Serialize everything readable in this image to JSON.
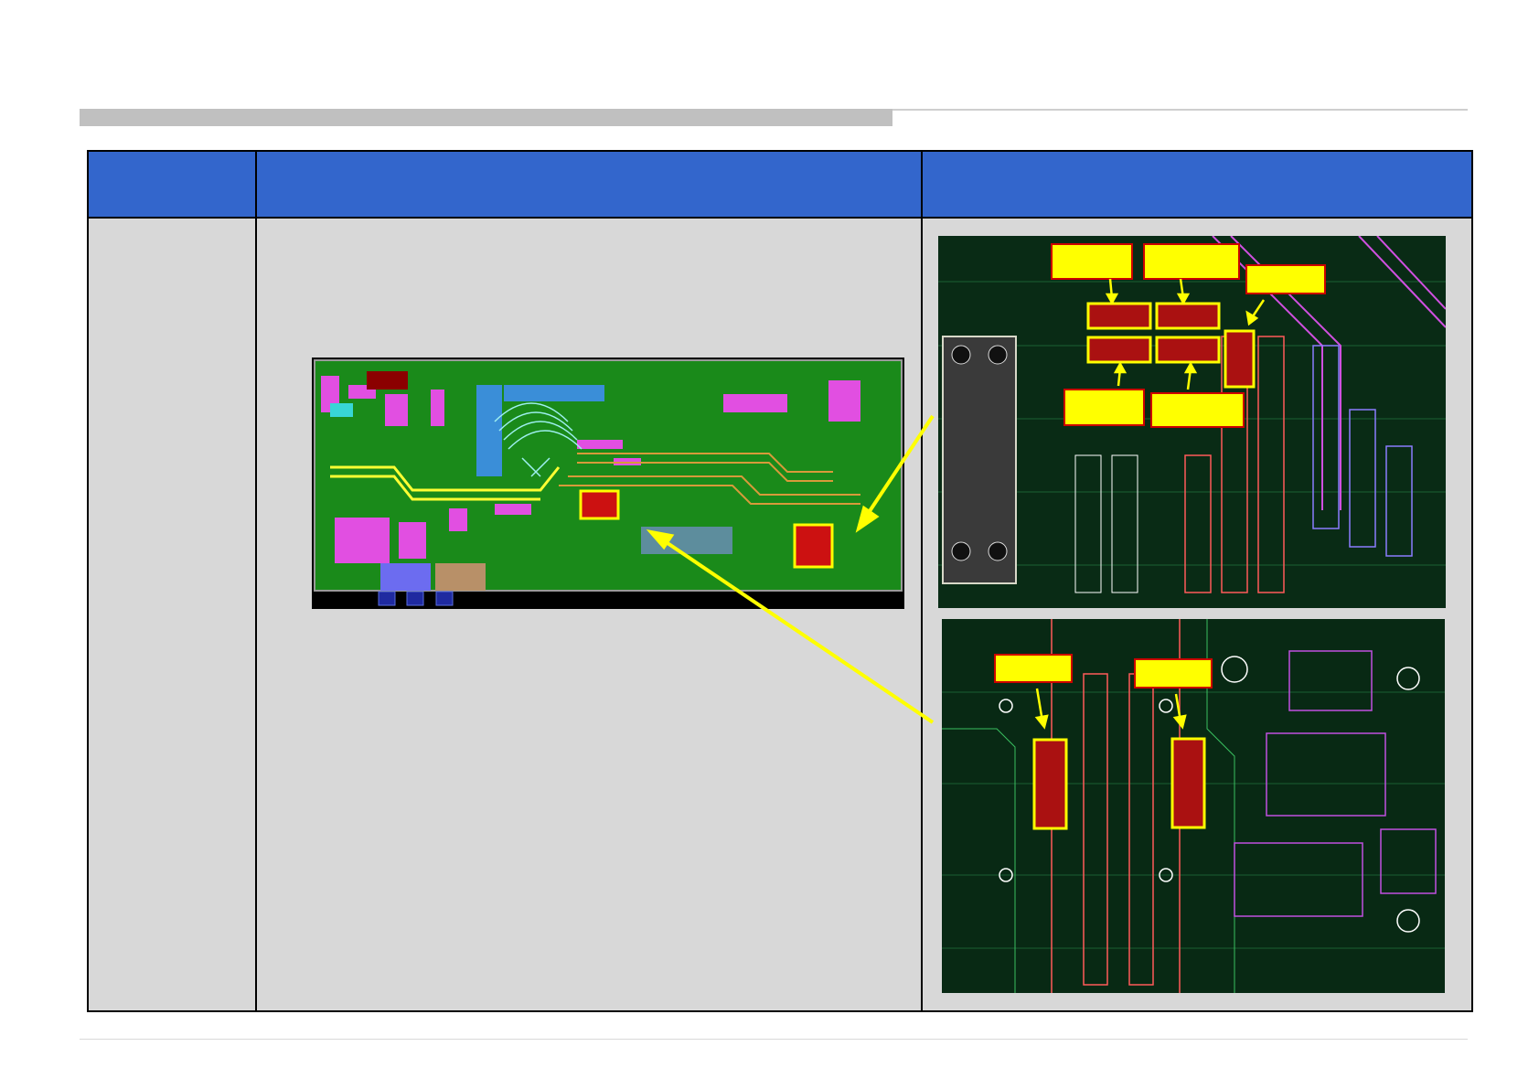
{
  "slide": {
    "title": "",
    "header_color": "#3366cc",
    "callout_color": "#ffff00",
    "highlight_color": "#cc0000"
  },
  "table": {
    "headers": [
      "",
      "",
      ""
    ],
    "row": {
      "col1": "",
      "col2": "",
      "col3": ""
    }
  },
  "images": {
    "overview": "pcb-layout-overview",
    "zoom_top": "pcb-zoom-top",
    "zoom_bottom": "pcb-zoom-bottom"
  },
  "callouts": {
    "top_labels": [
      "",
      "",
      "",
      "",
      ""
    ],
    "bottom_labels": [
      "",
      ""
    ]
  }
}
